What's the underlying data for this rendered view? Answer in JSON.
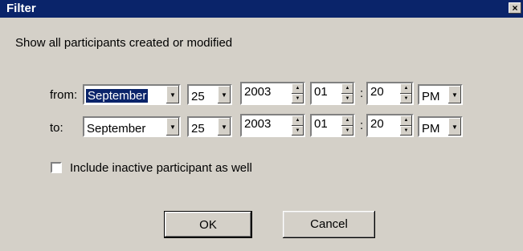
{
  "window": {
    "title": "Filter",
    "close_glyph": "×"
  },
  "description": "Show all participants created or modified",
  "from": {
    "label": "from:",
    "month": "September",
    "day": "25",
    "year": "2003",
    "hour": "01",
    "separator": ":",
    "minute": "20",
    "ampm": "PM"
  },
  "to": {
    "label": "to:",
    "month": "September",
    "day": "25",
    "year": "2003",
    "hour": "01",
    "separator": ":",
    "minute": "20",
    "ampm": "PM"
  },
  "include_inactive": {
    "label": "Include inactive participant as well",
    "checked": false
  },
  "buttons": {
    "ok": "OK",
    "cancel": "Cancel"
  },
  "icons": {
    "dropdown": "chevron-down-icon",
    "spin_up": "arrow-up-icon",
    "spin_down": "arrow-down-icon"
  },
  "colors": {
    "titlebar": "#0a246a",
    "dialog_bg": "#d4d0c8",
    "selection": "#0a246a"
  }
}
